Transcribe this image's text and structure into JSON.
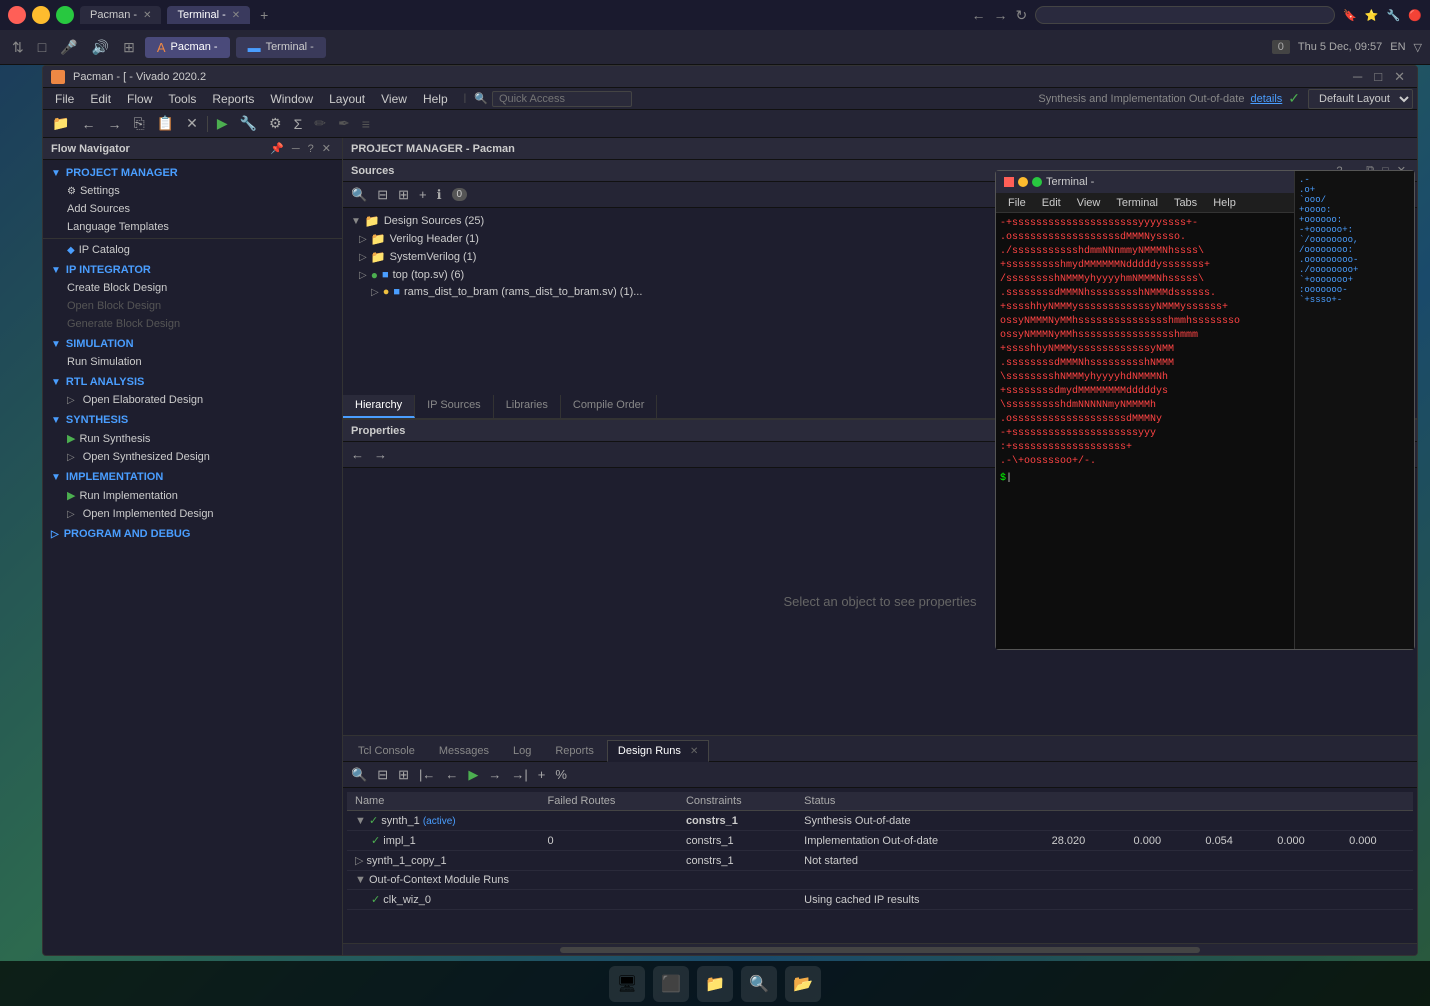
{
  "taskbar": {
    "tabs": [
      {
        "label": "Pacman -",
        "active": false,
        "id": "pacman-tab"
      },
      {
        "label": "Terminal -",
        "active": true,
        "id": "terminal-tab"
      }
    ],
    "datetime": "Thu  5 Dec, 09:57",
    "language": "EN",
    "address_placeholder": ""
  },
  "title_bar": {
    "text": "Pacman - [  - Vivado 2020.2",
    "minimize": "─",
    "maximize": "□",
    "close": "✕"
  },
  "menu": {
    "items": [
      "File",
      "Edit",
      "Flow",
      "Tools",
      "Reports",
      "Window",
      "Layout",
      "View",
      "Help"
    ],
    "quick_access_placeholder": "Quick Access",
    "status": "Synthesis and Implementation Out-of-date",
    "details": "details",
    "layout": "Default Layout"
  },
  "flow_navigator": {
    "title": "Flow Navigator",
    "sections": [
      {
        "id": "project-manager",
        "label": "PROJECT MANAGER",
        "expanded": true,
        "items": [
          {
            "label": "Settings",
            "icon": "⚙",
            "disabled": false
          },
          {
            "label": "Add Sources",
            "disabled": false
          },
          {
            "label": "Language Templates",
            "disabled": false
          },
          {
            "label": "",
            "separator": true
          },
          {
            "label": "IP Catalog",
            "icon": "◆",
            "disabled": false
          }
        ]
      },
      {
        "id": "ip-integrator",
        "label": "IP INTEGRATOR",
        "expanded": true,
        "items": [
          {
            "label": "Create Block Design",
            "disabled": false
          },
          {
            "label": "Open Block Design",
            "disabled": true
          },
          {
            "label": "Generate Block Design",
            "disabled": true
          }
        ]
      },
      {
        "id": "simulation",
        "label": "SIMULATION",
        "expanded": true,
        "items": [
          {
            "label": "Run Simulation",
            "disabled": false
          }
        ]
      },
      {
        "id": "rtl-analysis",
        "label": "RTL ANALYSIS",
        "expanded": true,
        "items": [
          {
            "label": "Open Elaborated Design",
            "hasArrow": true,
            "disabled": false
          }
        ]
      },
      {
        "id": "synthesis",
        "label": "SYNTHESIS",
        "expanded": true,
        "items": [
          {
            "label": "Run Synthesis",
            "icon": "▶",
            "iconColor": "green",
            "disabled": false
          },
          {
            "label": "Open Synthesized Design",
            "hasArrow": true,
            "disabled": false
          }
        ]
      },
      {
        "id": "implementation",
        "label": "IMPLEMENTATION",
        "expanded": true,
        "items": [
          {
            "label": "Run Implementation",
            "icon": "▶",
            "iconColor": "green",
            "disabled": false
          },
          {
            "label": "Open Implemented Design",
            "hasArrow": true,
            "disabled": false
          }
        ]
      },
      {
        "id": "program-debug",
        "label": "PROGRAM AND DEBUG",
        "expanded": false,
        "items": []
      }
    ]
  },
  "sources_panel": {
    "title": "Sources",
    "count": 0,
    "tabs": [
      "Hierarchy",
      "IP Sources",
      "Libraries",
      "Compile Order"
    ],
    "active_tab": "Hierarchy",
    "tree": [
      {
        "label": "Design Sources (25)",
        "level": 0,
        "type": "folder",
        "expanded": true
      },
      {
        "label": "Verilog Header (1)",
        "level": 1,
        "type": "folder",
        "expanded": false
      },
      {
        "label": "SystemVerilog (1)",
        "level": 1,
        "type": "folder",
        "expanded": false
      },
      {
        "label": "top (top.sv) (6)",
        "level": 1,
        "type": "file-top",
        "expanded": false
      },
      {
        "label": "rams_dist_to_bram (rams_dist_to_bram.sv) (1)...",
        "level": 2,
        "type": "file",
        "expanded": false
      }
    ]
  },
  "properties_panel": {
    "title": "Properties",
    "empty_text": "Select an object to see properties"
  },
  "console": {
    "tabs": [
      {
        "label": "Tcl Console",
        "closeable": false
      },
      {
        "label": "Messages",
        "closeable": false
      },
      {
        "label": "Log",
        "closeable": false
      },
      {
        "label": "Reports",
        "closeable": false
      },
      {
        "label": "Design Runs",
        "closeable": true,
        "active": true
      }
    ],
    "design_runs": {
      "columns": [
        "Name",
        "Failed Routes",
        "Constraints",
        "Status",
        "",
        "",
        "",
        "",
        ""
      ],
      "rows": [
        {
          "indent": 0,
          "expand": "▼",
          "check": "✓",
          "name": "synth_1",
          "active": "(active)",
          "failed_routes": "",
          "constraints": "constrs_1",
          "status": "Synthesis Out-of-date",
          "status_class": "outofdate",
          "cols": [
            "",
            "",
            "",
            "",
            ""
          ]
        },
        {
          "indent": 1,
          "expand": "",
          "check": "✓",
          "name": "impl_1",
          "active": "",
          "failed_routes": "0",
          "constraints": "constrs_1",
          "status": "Implementation Out-of-date",
          "status_class": "impl-outofdate",
          "cols": [
            "28.020",
            "0.000",
            "0.054",
            "0.000",
            "0.000"
          ]
        },
        {
          "indent": 0,
          "expand": "▷",
          "check": "",
          "name": "synth_1_copy_1",
          "active": "",
          "failed_routes": "",
          "constraints": "constrs_1",
          "status": "Not started",
          "status_class": "notstarted",
          "cols": [
            "",
            "",
            "",
            "",
            ""
          ]
        },
        {
          "indent": 0,
          "expand": "▼",
          "check": "",
          "name": "Out-of-Context Module Runs",
          "active": "",
          "failed_routes": "",
          "constraints": "",
          "status": "",
          "status_class": "",
          "cols": [
            "",
            "",
            "",
            "",
            ""
          ],
          "is_group": true
        },
        {
          "indent": 1,
          "expand": "",
          "check": "✓",
          "name": "clk_wiz_0",
          "active": "",
          "failed_routes": "",
          "constraints": "",
          "status": "Using cached IP results",
          "status_class": "cached",
          "cols": [
            "",
            "",
            "",
            "",
            ""
          ]
        }
      ]
    }
  },
  "terminal": {
    "title": "Terminal -",
    "menu": [
      "File",
      "Edit",
      "View",
      "Terminal",
      "Tabs",
      "Help"
    ],
    "lines": [
      "-+sssssssssssssssssssssyyyyssss+-",
      ".ossssssssssssssssssdMMMNyssso.",
      "./ssssssssssshdmmNNnmmyNMMMNhssss\\",
      "+ssssssssshmydMMMMMMNdddddysssssss+",
      "/sssssssshNMMMyhyyyyhmNMMMNhsssss\\",
      ".ssssssssdMMMNhsssssssshNMMMdssssss.",
      "+sssshhyNMMMyssssssssssssyNMMMyssssss+",
      "ossyNMMMNyMMhssssssssssssssshmmhssssssso",
      "ossyNMMMNyMMhsssssssssssssssshmmm",
      "+sssshhyNMMMyssssssssssssyNMM",
      ".ssssssssdMMMNhssssssssshNMMM",
      "\\sssssssshNMMMyhyyyyhdNMMMNh",
      "+ssssssssdmydMMMMMMMMdddddys",
      "\\ssssssssshdmNNNNNmyNMMMMh",
      ".osssssssssssssssssssdMMMNy",
      "-+sssssssssssssssssssssyyy",
      ":+sssssssssssssssssss+",
      ".-\\+oossssoo+/-."
    ]
  },
  "pm_title": "PROJECT MANAGER - Pacman",
  "icons": {
    "search": "🔍",
    "collapse_all": "⊟",
    "expand_all": "⊞",
    "add": "+",
    "info": "ℹ",
    "gear": "⚙",
    "nav_back": "←",
    "nav_fwd": "→",
    "close": "✕",
    "minimize": "─",
    "maximize": "□",
    "question": "?",
    "float": "⧉",
    "detach": "□"
  }
}
